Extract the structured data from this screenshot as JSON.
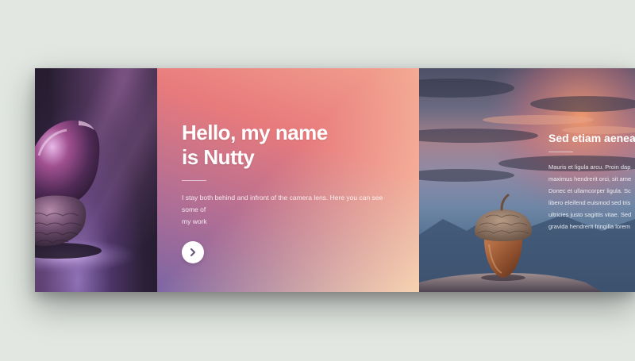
{
  "hero": {
    "title_line1": "Hello, my name",
    "title_line2": "is Nutty",
    "text_line1": "I stay both behind and infront of the camera lens. Here you can see some of",
    "text_line2": "my work",
    "next_icon": "chevron-right-icon"
  },
  "secondary": {
    "title": "Sed etiam aenea",
    "lines": [
      "Mauris et ligula arcu. Proin dap",
      "maximus hendrerit orci, sit ame",
      "Donec et ullamcorper ligula. Sc",
      "libero eleifend euismod sed tris",
      "ultricies justo sagittis vitae. Sed",
      "gravida hendrerit fringilla lorem"
    ]
  },
  "colors": {
    "page_background": "#e2e7e2",
    "button_background": "#ffffff",
    "chevron": "#6d5a7e"
  }
}
